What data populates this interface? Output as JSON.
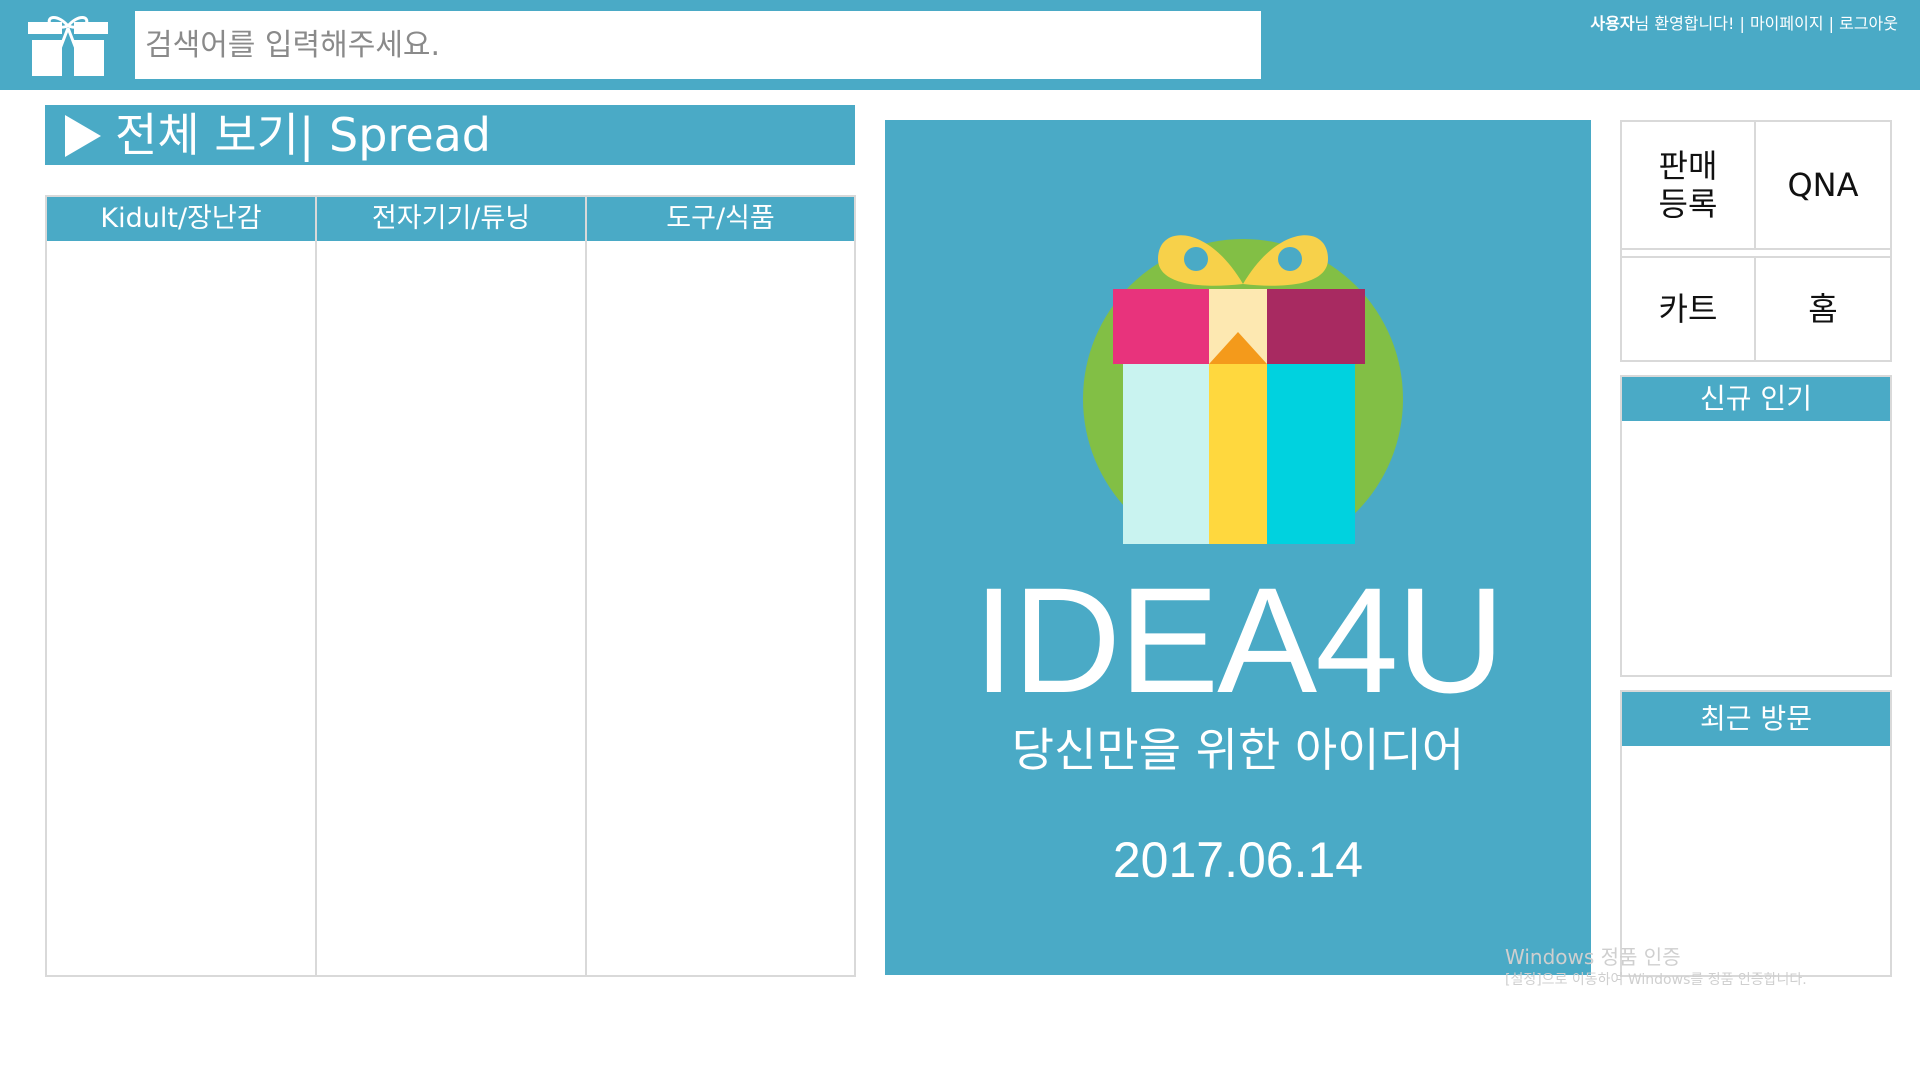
{
  "header": {
    "search_placeholder": "검색어를 입력해주세요.",
    "user_name": "사용자",
    "welcome_text": "님 환영합니다!",
    "separator": " | ",
    "mypage_label": "마이페이지",
    "logout_label": "로그아웃",
    "bar_color": "#4aaac6",
    "logo_icon": "gift-icon"
  },
  "spread": {
    "title": "전체 보기| Spread",
    "columns": [
      "Kidult/장난감",
      "전자기기/튜닝",
      "도구/식품"
    ]
  },
  "banner": {
    "brand": "IDEA4U",
    "tagline": "당신만을 위한 아이디어",
    "date": "2017.06.14",
    "icon": "gift-box-icon"
  },
  "quick_menu": {
    "sell_label_1": "판매",
    "sell_label_2": "등록",
    "qna_label": "QNA",
    "cart_label": "카트",
    "home_label": "홈"
  },
  "panels": {
    "new_popular": "신규 인기",
    "recent_visit": "최근 방문"
  },
  "watermark": {
    "line1": "Windows 정품 인증",
    "line2": "[설정]으로 이동하여 Windows를 정품 인증합니다."
  },
  "colors": {
    "accent": "#4aaac6",
    "border": "#d9d9d9"
  }
}
